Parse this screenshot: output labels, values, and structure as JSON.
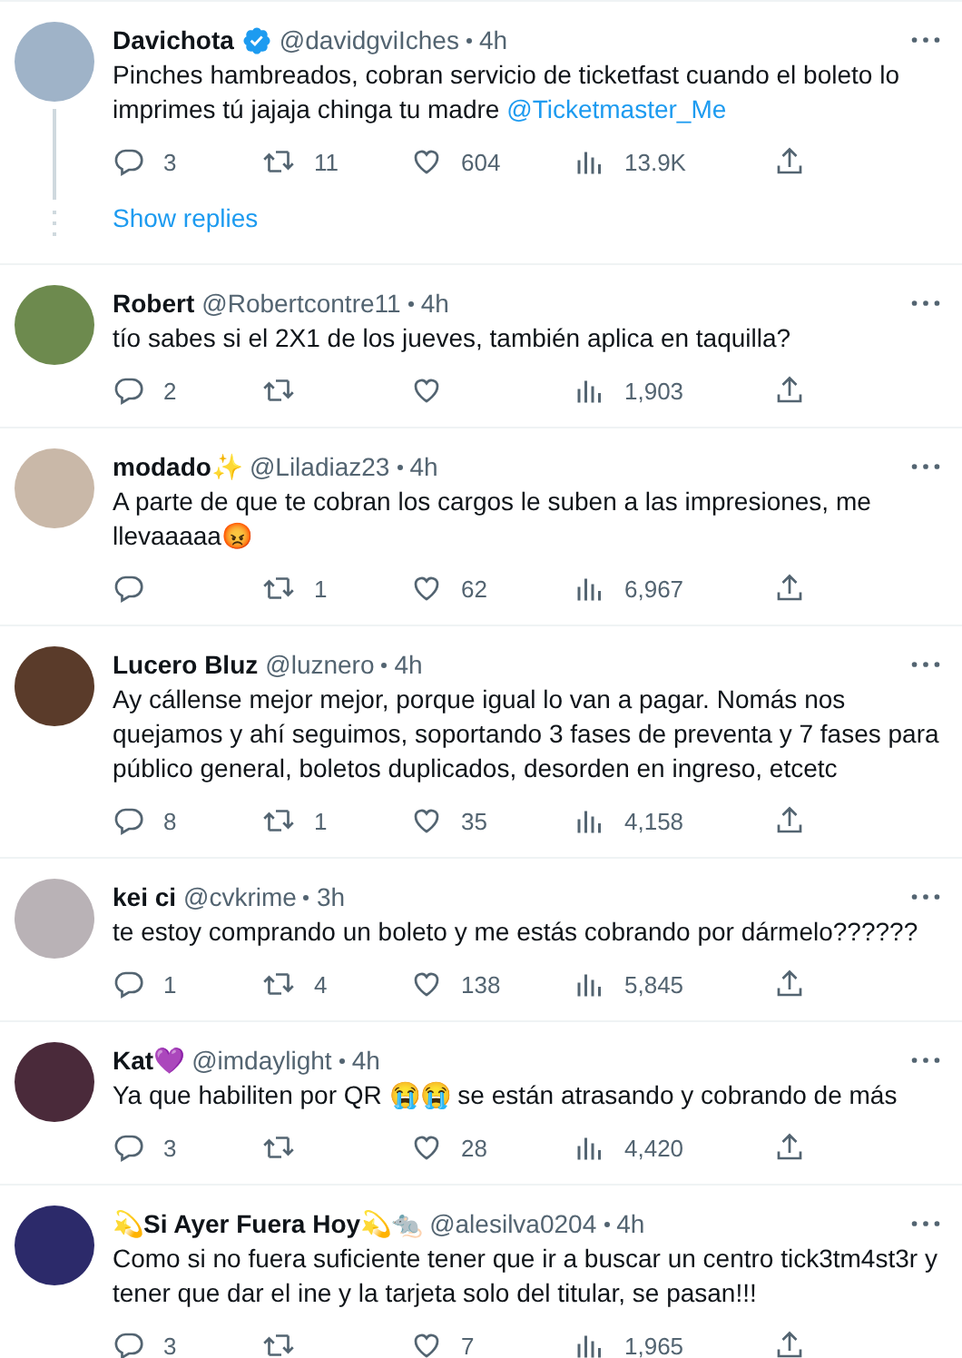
{
  "tweets": [
    {
      "name": "Davichota",
      "verified": true,
      "handle": "@davidgviIches",
      "time": "4h",
      "text": "Pinches hambreados, cobran servicio de ticketfast cuando el boleto lo imprimes tú jajaja chinga tu madre **@Ticketmaster_Me**",
      "replies": "3",
      "retweets": "11",
      "likes": "604",
      "views": "13.9K",
      "show_replies": "Show replies"
    },
    {
      "name": "Robert",
      "verified": false,
      "handle": "@Robertcontre11",
      "time": "4h",
      "text": "tío sabes si el 2X1 de los jueves, también aplica en taquilla?",
      "replies": "2",
      "views": "1,903"
    },
    {
      "name": "modado✨",
      "verified": false,
      "handle": "@Liladiaz23",
      "time": "4h",
      "text": "A parte de que te cobran los cargos le suben a las impresiones, me llevaaaaa😡",
      "retweets": "1",
      "likes": "62",
      "views": "6,967"
    },
    {
      "name": "Lucero Bluz",
      "verified": false,
      "handle": "@luznero",
      "time": "4h",
      "text": "Ay cállense mejor mejor, porque igual lo van a pagar. Nomás nos quejamos y ahí seguimos, soportando 3 fases de preventa y 7 fases para público general, boletos duplicados, desorden en ingreso, etcetc",
      "replies": "8",
      "retweets": "1",
      "likes": "35",
      "views": "4,158"
    },
    {
      "name": "kei ci",
      "verified": false,
      "handle": "@cvkrime",
      "time": "3h",
      "text": "te estoy comprando un boleto y me estás cobrando por dármelo??????",
      "replies": "1",
      "retweets": "4",
      "likes": "138",
      "views": "5,845"
    },
    {
      "name": "Kat💜",
      "verified": false,
      "handle": "@imdaylight",
      "time": "4h",
      "text": "Ya que habiliten por QR 😭😭 se están atrasando y cobrando de más",
      "replies": "3",
      "likes": "28",
      "views": "4,420"
    },
    {
      "name": "💫Si Ayer Fuera Hoy💫🐀",
      "verified": false,
      "handle": "@alesilva0204",
      "time": "4h",
      "text": "Como si no fuera suficiente tener que ir a buscar un centro tick3tm4st3r y tener que dar el ine y la tarjeta solo del titular, se pasan!!!",
      "replies": "3",
      "likes": "7",
      "views": "1,965"
    }
  ]
}
